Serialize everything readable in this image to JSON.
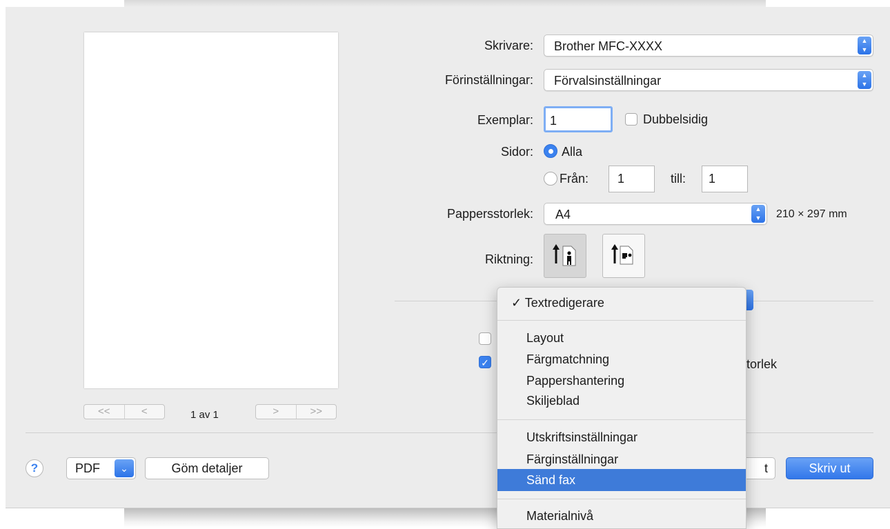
{
  "printer": {
    "label": "Skrivare:",
    "value": "Brother MFC-XXXX"
  },
  "presets": {
    "label": "Förinställningar:",
    "value": "Förvalsinställningar"
  },
  "copies": {
    "label": "Exemplar:",
    "value": "1",
    "duplex_label": "Dubbelsidig",
    "duplex_checked": false
  },
  "pages": {
    "label": "Sidor:",
    "all_label": "Alla",
    "from_label": "Från:",
    "from_value": "1",
    "to_label": "till:",
    "to_value": "1",
    "selected": "all"
  },
  "paper": {
    "label": "Pappersstorlek:",
    "value": "A4",
    "dimensions": "210 × 297 mm"
  },
  "orientation": {
    "label": "Riktning:",
    "selected": "portrait"
  },
  "preview": {
    "first_label": "<<",
    "prev_label": "<",
    "next_label": ">",
    "last_label": ">>",
    "page_counter": "1 av 1"
  },
  "background_options": {
    "partial_label": "torlek",
    "checkbox1_checked": false,
    "checkbox2_checked": true
  },
  "menu": {
    "checked_item": "Textredigerare",
    "items": [
      "Layout",
      "Färgmatchning",
      "Pappershantering",
      "Skiljeblad",
      "Utskriftsinställningar",
      "Färginställningar",
      "Sänd fax",
      "Materialnivå"
    ],
    "highlighted": "Sänd fax"
  },
  "footer": {
    "help": "?",
    "pdf_label": "PDF",
    "hide_details": "Göm detaljer",
    "cancel_partial": "t",
    "print_label": "Skriv ut"
  },
  "colors": {
    "accent": "#3b82ef",
    "highlight": "#3e7bd9",
    "dialog_bg": "#ececec"
  }
}
